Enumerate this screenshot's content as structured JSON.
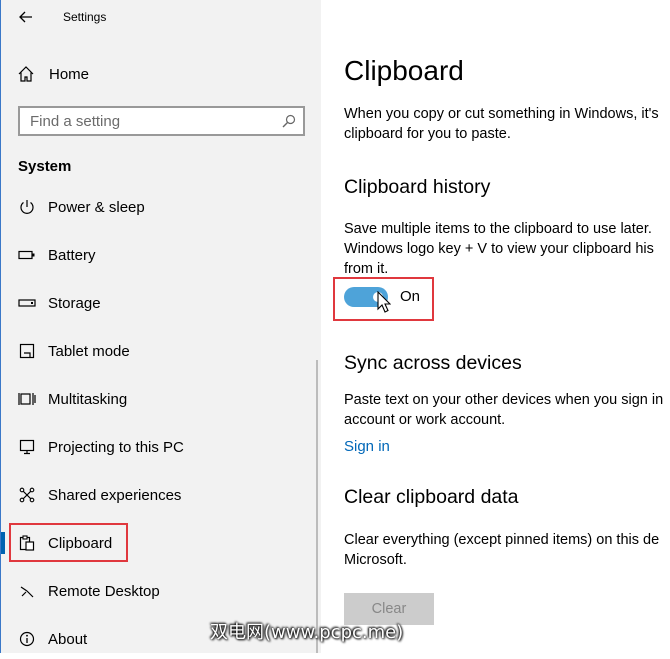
{
  "window": {
    "title": "Settings"
  },
  "sidebar": {
    "home_label": "Home",
    "search_placeholder": "Find a setting",
    "section_title": "System",
    "items": [
      {
        "label": "Power & sleep",
        "icon": "power-icon"
      },
      {
        "label": "Battery",
        "icon": "battery-icon"
      },
      {
        "label": "Storage",
        "icon": "storage-icon"
      },
      {
        "label": "Tablet mode",
        "icon": "tablet-icon"
      },
      {
        "label": "Multitasking",
        "icon": "multitasking-icon"
      },
      {
        "label": "Projecting to this PC",
        "icon": "projecting-icon"
      },
      {
        "label": "Shared experiences",
        "icon": "shared-icon"
      },
      {
        "label": "Clipboard",
        "icon": "clipboard-icon",
        "active": true
      },
      {
        "label": "Remote Desktop",
        "icon": "remote-desktop-icon"
      },
      {
        "label": "About",
        "icon": "info-icon"
      }
    ]
  },
  "main": {
    "title": "Clipboard",
    "intro_line1": "When you copy or cut something in Windows, it's",
    "intro_line2": "clipboard for you to paste.",
    "history": {
      "heading": "Clipboard history",
      "line1": "Save multiple items to the clipboard to use later.",
      "line2": "Windows logo key + V to view your clipboard his",
      "line3": "from it.",
      "toggle_state": "On"
    },
    "sync": {
      "heading": "Sync across devices",
      "line1": "Paste text on your other devices when you sign in",
      "line2": "account or work account.",
      "link": "Sign in"
    },
    "clear": {
      "heading": "Clear clipboard data",
      "line1": "Clear everything (except pinned items) on this de",
      "line2": "Microsoft.",
      "button": "Clear"
    }
  },
  "watermark": "双电网(www.pcpc.me)",
  "colors": {
    "accent": "#0063b1",
    "toggle": "#4ea3d9",
    "highlight": "#e0383e",
    "link": "#0067b8"
  }
}
